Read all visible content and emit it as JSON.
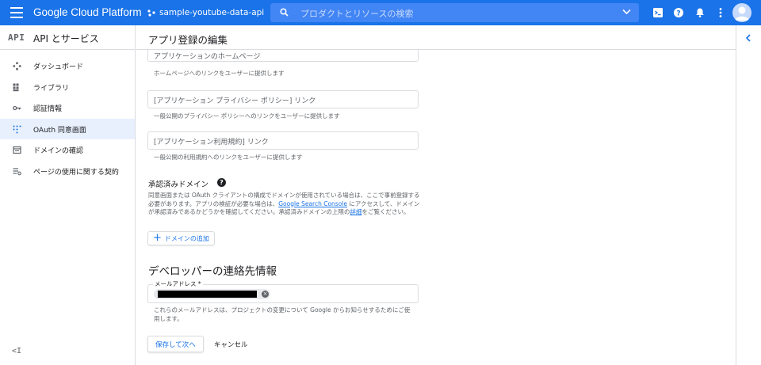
{
  "topbar": {
    "brand": "Google Cloud Platform",
    "project": "sample-youtube-data-api",
    "search_placeholder": "プロダクトとリソースの検索",
    "accent": "#1a73e8"
  },
  "sidebar": {
    "logo": "API",
    "title": "API とサービス",
    "items": [
      {
        "label": "ダッシュボード",
        "icon": "dashboard-icon"
      },
      {
        "label": "ライブラリ",
        "icon": "library-icon"
      },
      {
        "label": "認証情報",
        "icon": "key-icon"
      },
      {
        "label": "OAuth 同意画面",
        "icon": "consent-icon",
        "active": true
      },
      {
        "label": "ドメインの確認",
        "icon": "domain-check-icon"
      },
      {
        "label": "ページの使用に関する契約",
        "icon": "page-agreement-icon"
      }
    ],
    "collapse": "<I"
  },
  "main": {
    "title": "アプリ登録の編集",
    "fields": [
      {
        "placeholder": "アプリケーションのホームページ",
        "help": "ホームページへのリンクをユーザーに提供します"
      },
      {
        "placeholder": "[アプリケーション プライバシー ポリシー] リンク",
        "help": "一般公開のプライバシー ポリシーへのリンクをユーザーに提供します"
      },
      {
        "placeholder": "[アプリケーション利用規約] リンク",
        "help": "一般公開の利用規約へのリンクをユーザーに提供します"
      }
    ],
    "authorized_domains": {
      "title": "承認済みドメイン",
      "help_icon": "?",
      "desc_part1": "同意画面または OAuth クライアントの構成でドメインが使用されている場合は、ここで事前登録する必要があります。アプリの検証が必要な場合は、",
      "desc_link1": "Google Search Console",
      "desc_part2": " にアクセスして、ドメインが承認済みであるかどうかを確認してください。承認済みドメインの上限の",
      "desc_link2": "詳細",
      "desc_part3": "をご覧ください。",
      "add_button": "ドメインの追加"
    },
    "developer_contact": {
      "title": "デベロッパーの連絡先情報",
      "email_label": "メールアドレス *",
      "help": "これらのメールアドレスは、プロジェクトの変更について Google からお知らせするためにご使用します。"
    },
    "save_button": "保存して次へ",
    "cancel_button": "キャンセル"
  }
}
